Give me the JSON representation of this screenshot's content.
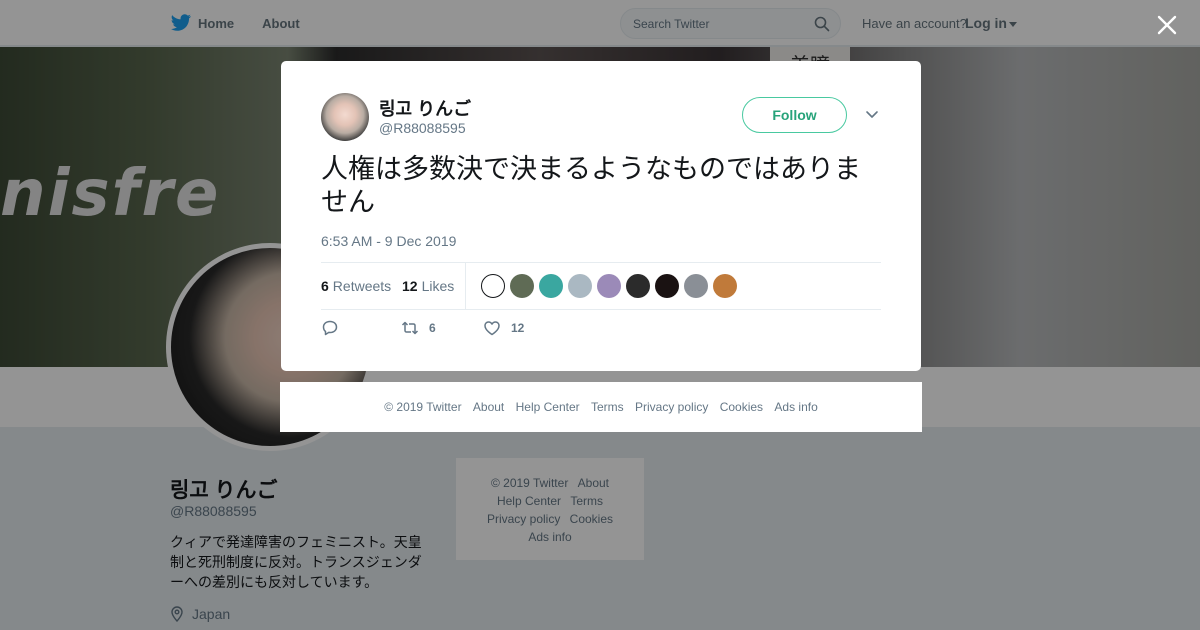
{
  "nav": {
    "home_label": "Home",
    "about_label": "About",
    "search_placeholder": "Search Twitter",
    "have_account": "Have an account?",
    "login_label": "Log in"
  },
  "header": {
    "sign_text": "nisfre",
    "board_text": "美瞳"
  },
  "profile": {
    "name": "링고 りんご",
    "handle": "@R88088595",
    "bio": "クィアで発達障害のフェミニスト。天皇制と死刑制度に反対。トランスジェンダーへの差別にも反対しています。",
    "location": "Japan"
  },
  "side_footer": {
    "links": [
      "© 2019 Twitter",
      "About",
      "Help Center",
      "Terms",
      "Privacy policy",
      "Cookies",
      "Ads info"
    ]
  },
  "tweet": {
    "author_name": "링고 りんご",
    "author_handle": "@R88088595",
    "follow_label": "Follow",
    "text": "人権は多数決で決まるようなものではありません",
    "timestamp": "6:53 AM - 9 Dec 2019",
    "retweet_count": "6",
    "retweet_label": "Retweets",
    "like_count": "12",
    "like_label": "Likes",
    "reply_action_count": "",
    "retweet_action_count": "6",
    "like_action_count": "12",
    "liker_colors": [
      "#ffffff",
      "#5f6b55",
      "#3aa7a0",
      "#aab8c2",
      "#9b8ab8",
      "#2b2b2b",
      "#1a1212",
      "#8a8f96",
      "#c07a3a"
    ]
  },
  "modal_footer": {
    "links": [
      "© 2019 Twitter",
      "About",
      "Help Center",
      "Terms",
      "Privacy policy",
      "Cookies",
      "Ads info"
    ]
  },
  "colors": {
    "accent": "#1da1f2",
    "follow": "#27a37a",
    "muted": "#657786"
  }
}
